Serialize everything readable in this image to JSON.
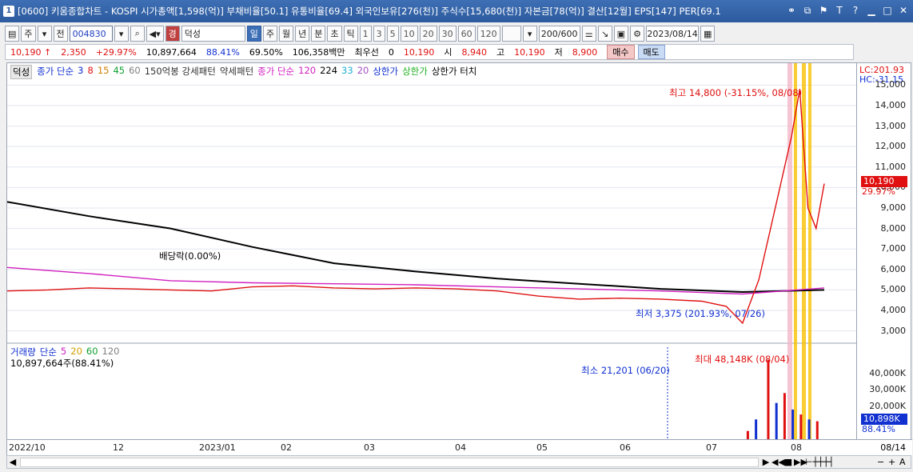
{
  "window": {
    "num": "1",
    "title": "[0600] 키움종합차트 - KOSPI 시가총액[1,598(억)] 부채비율[50.1] 유통비율[69.4] 외국인보유[276(천)] 주식수[15,680(천)] 자본금[78(억)] 결산[12월] EPS[147] PER[69.1"
  },
  "toolbar": {
    "period_sel": "주",
    "prev_label": "전",
    "code": "004830",
    "stock_name": "덕성",
    "stock_badge": "경",
    "periods": [
      "일",
      "주",
      "월",
      "년",
      "분",
      "초",
      "틱"
    ],
    "intervals": [
      "1",
      "3",
      "5",
      "10",
      "20",
      "30",
      "60",
      "120"
    ],
    "count": "200/600",
    "date": "2023/08/14"
  },
  "quote": {
    "price": "10,190",
    "arrow": "↑",
    "change": "2,350",
    "pct": "+29.97%",
    "volume": "10,897,664",
    "vol_pct": "88.41%",
    "turnover": "69.50%",
    "amount": "106,358백만",
    "best": "최우선",
    "best_val": "0",
    "cur": "10,190",
    "open_l": "시",
    "open": "8,940",
    "high_l": "고",
    "high": "10,190",
    "low_l": "저",
    "low": "8,900",
    "buy": "매수",
    "sell": "매도"
  },
  "legend_price": {
    "name": "덕성",
    "items": [
      {
        "t": "종가 단순",
        "c": "#1030d0"
      },
      {
        "t": "3",
        "c": "#1030d0"
      },
      {
        "t": "8",
        "c": "#e01010"
      },
      {
        "t": "15",
        "c": "#d08000"
      },
      {
        "t": "45",
        "c": "#10a030"
      },
      {
        "t": "60",
        "c": "#808080"
      },
      {
        "t": "150억봉 강세패턴",
        "c": "#333"
      },
      {
        "t": "약세패턴",
        "c": "#333"
      },
      {
        "t": "종가 단순",
        "c": "#d020c0"
      },
      {
        "t": "120",
        "c": "#d020c0"
      },
      {
        "t": "224",
        "c": "#000"
      },
      {
        "t": "33",
        "c": "#20b0d0"
      },
      {
        "t": "20",
        "c": "#a050c0"
      },
      {
        "t": "상한가",
        "c": "#1030d0"
      },
      {
        "t": "상한가",
        "c": "#20b020"
      },
      {
        "t": "상한가 터치",
        "c": "#000"
      }
    ]
  },
  "legend_vol": {
    "items": [
      {
        "t": "거래량",
        "c": "#1030d0"
      },
      {
        "t": "단순",
        "c": "#1030d0"
      },
      {
        "t": "5",
        "c": "#d020c0"
      },
      {
        "t": "20",
        "c": "#d0a000"
      },
      {
        "t": "60",
        "c": "#10a030"
      },
      {
        "t": "120",
        "c": "#808080"
      }
    ],
    "value": "10,897,664주(88.41%)"
  },
  "axis_right": {
    "lc": "LC:201.93",
    "hc": "HC:-31.15",
    "price_badge": "10,190",
    "price_pct": "29.97%",
    "vol_badge": "10,898K",
    "vol_pct": "88.41%",
    "date_badge": "08/14"
  },
  "annotations": {
    "high": "최고 14,800 (-31.15%, 08/08)",
    "low": "최저 3,375 (201.93%, 07/26)",
    "dividend": "배당락(0.00%)",
    "vol_max": "최대 48,148K (08/04)",
    "vol_min": "최소 21,201 (06/20)"
  },
  "colors": {
    "up": "#e01010",
    "down": "#1030d0",
    "title_bar": "#2d5a9e"
  },
  "chart_data": {
    "type": "line",
    "y_ticks": [
      3000,
      4000,
      5000,
      6000,
      7000,
      8000,
      9000,
      10000,
      11000,
      12000,
      13000,
      14000,
      15000
    ],
    "ylim": [
      2400,
      15600
    ],
    "vol_ticks": [
      "10,000K",
      "20,000K",
      "30,000K",
      "40,000K"
    ],
    "vol_ylim": [
      0,
      50000
    ],
    "x_ticks": [
      "2022/10",
      "12",
      "2023/01",
      "02",
      "03",
      "04",
      "05",
      "06",
      "07",
      "08"
    ],
    "series": [
      {
        "name": "224",
        "color": "#000000",
        "values": [
          [
            0,
            9300
          ],
          [
            0.1,
            8600
          ],
          [
            0.2,
            8000
          ],
          [
            0.3,
            7100
          ],
          [
            0.4,
            6300
          ],
          [
            0.5,
            5900
          ],
          [
            0.6,
            5550
          ],
          [
            0.7,
            5300
          ],
          [
            0.8,
            5050
          ],
          [
            0.9,
            4900
          ],
          [
            1,
            5000
          ]
        ]
      },
      {
        "name": "120",
        "color": "#d020c0",
        "values": [
          [
            0,
            6100
          ],
          [
            0.1,
            5800
          ],
          [
            0.2,
            5450
          ],
          [
            0.3,
            5350
          ],
          [
            0.4,
            5300
          ],
          [
            0.5,
            5250
          ],
          [
            0.6,
            5150
          ],
          [
            0.7,
            5050
          ],
          [
            0.8,
            4950
          ],
          [
            0.9,
            4800
          ],
          [
            1,
            5100
          ]
        ]
      },
      {
        "name": "price",
        "color": "#e01010",
        "values": [
          [
            0,
            4950
          ],
          [
            0.05,
            5000
          ],
          [
            0.1,
            5100
          ],
          [
            0.15,
            5050
          ],
          [
            0.2,
            5000
          ],
          [
            0.25,
            4950
          ],
          [
            0.3,
            5150
          ],
          [
            0.35,
            5200
          ],
          [
            0.4,
            5100
          ],
          [
            0.45,
            5050
          ],
          [
            0.5,
            5100
          ],
          [
            0.55,
            5050
          ],
          [
            0.6,
            4950
          ],
          [
            0.65,
            4700
          ],
          [
            0.7,
            4550
          ],
          [
            0.75,
            4600
          ],
          [
            0.8,
            4550
          ],
          [
            0.85,
            4450
          ],
          [
            0.88,
            4200
          ],
          [
            0.9,
            3375
          ],
          [
            0.92,
            5500
          ],
          [
            0.94,
            9000
          ],
          [
            0.96,
            12500
          ],
          [
            0.97,
            14800
          ],
          [
            0.98,
            9000
          ],
          [
            0.99,
            8000
          ],
          [
            1,
            10190
          ]
        ]
      }
    ],
    "volume_peak": 48148
  }
}
